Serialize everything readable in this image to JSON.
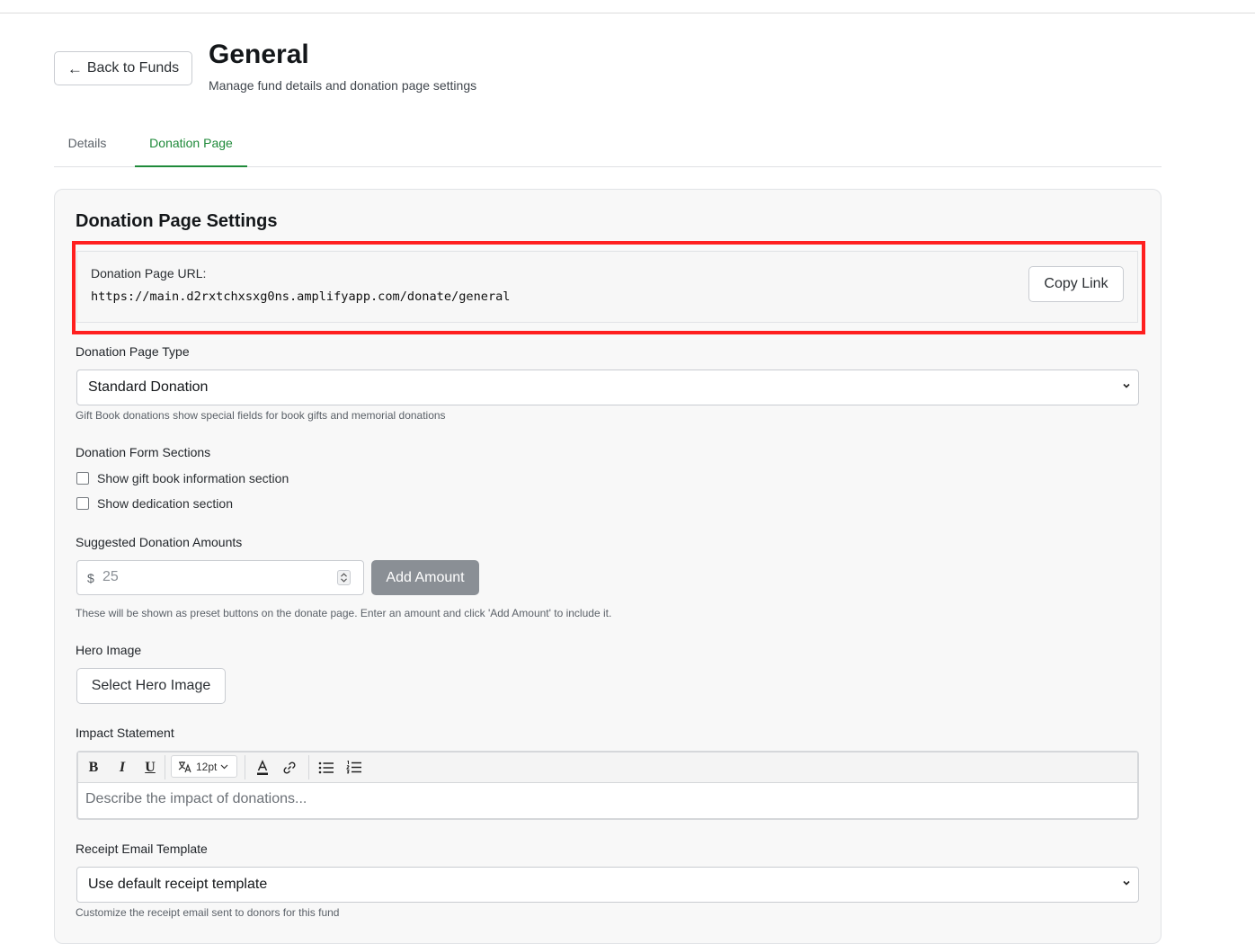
{
  "header": {
    "back_label": "Back to Funds",
    "back_arrow": "←",
    "title": "General",
    "subtitle": "Manage fund details and donation page settings"
  },
  "tabs": [
    {
      "label": "Details",
      "active": false
    },
    {
      "label": "Donation Page",
      "active": true
    }
  ],
  "card": {
    "title": "Donation Page Settings",
    "url": {
      "label": "Donation Page URL:",
      "value": "https://main.d2rxtchxsxg0ns.amplifyapp.com/donate/general",
      "copy_label": "Copy Link"
    },
    "page_type": {
      "label": "Donation Page Type",
      "selected": "Standard Donation",
      "help": "Gift Book donations show special fields for book gifts and memorial donations"
    },
    "form_sections": {
      "label": "Donation Form Sections",
      "options": [
        {
          "label": "Show gift book information section",
          "checked": false
        },
        {
          "label": "Show dedication section",
          "checked": false
        }
      ]
    },
    "amounts": {
      "label": "Suggested Donation Amounts",
      "currency": "$",
      "placeholder": "25",
      "add_label": "Add Amount",
      "help": "These will be shown as preset buttons on the donate page. Enter an amount and click 'Add Amount' to include it."
    },
    "hero": {
      "label": "Hero Image",
      "button_label": "Select Hero Image"
    },
    "impact": {
      "label": "Impact Statement",
      "toolbar": {
        "bold": "B",
        "italic": "I",
        "underline": "U",
        "font_size": "12pt"
      },
      "placeholder": "Describe the impact of donations..."
    },
    "receipt": {
      "label": "Receipt Email Template",
      "selected": "Use default receipt template",
      "help": "Customize the receipt email sent to donors for this fund"
    }
  },
  "colors": {
    "accent": "#1f8a3a",
    "highlight": "#ff1f1f",
    "disabled_button": "#8a8f95"
  }
}
